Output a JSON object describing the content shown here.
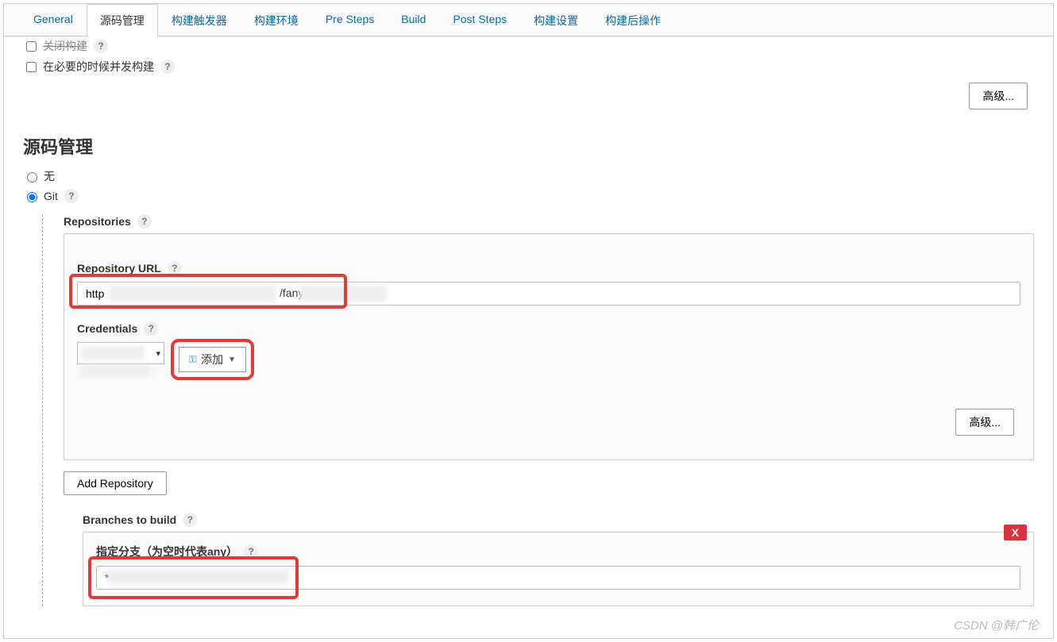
{
  "tabs": {
    "general": "General",
    "scm": "源码管理",
    "triggers": "构建触发器",
    "env": "构建环境",
    "presteps": "Pre Steps",
    "build": "Build",
    "poststeps": "Post Steps",
    "settings": "构建设置",
    "postbuild": "构建后操作"
  },
  "top_checks": {
    "close_build": "关闭构建",
    "concurrent": "在必要的时候并发构建"
  },
  "buttons": {
    "advanced": "高级...",
    "add_repo": "Add Repository",
    "add": "添加"
  },
  "section": {
    "scm_title": "源码管理",
    "none": "无",
    "git": "Git",
    "repositories": "Repositories",
    "repo_url": "Repository URL",
    "credentials": "Credentials",
    "branches": "Branches to build",
    "branch_spec": "指定分支（为空时代表any）"
  },
  "values": {
    "repo_url_prefix": "http",
    "repo_url_mid": "/fanyl",
    "branch_prefix": "*"
  },
  "delete_label": "X",
  "watermark": "CSDN @韩广伦"
}
